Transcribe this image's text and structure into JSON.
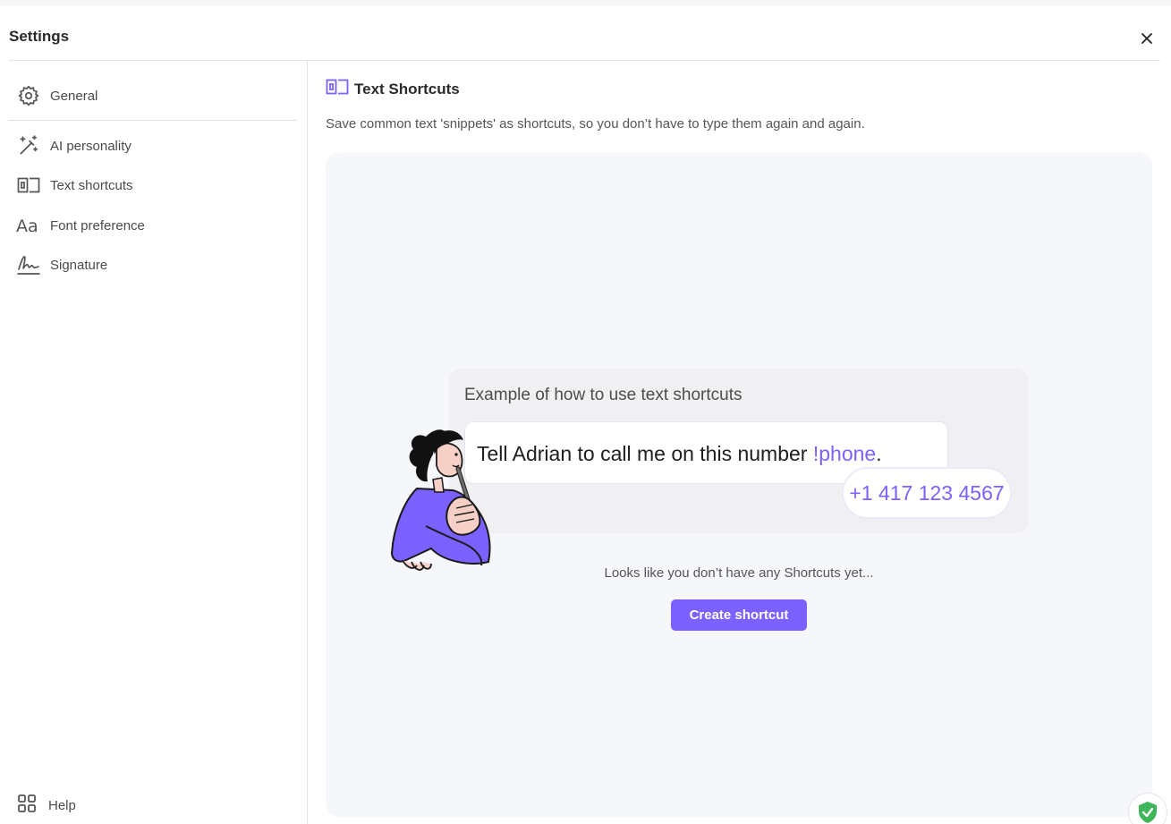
{
  "window": {
    "title": "Settings"
  },
  "sidebar": {
    "items": [
      {
        "label": "General",
        "icon": "gear-icon"
      },
      {
        "label": "AI personality",
        "icon": "magic-wand-icon"
      },
      {
        "label": "Text shortcuts",
        "icon": "text-shortcut-icon"
      },
      {
        "label": "Font preference",
        "icon": "font-icon"
      },
      {
        "label": "Signature",
        "icon": "signature-icon"
      }
    ],
    "help_label": "Help"
  },
  "main": {
    "section_title": "Text Shortcuts",
    "description": "Save common text 'snippets' as shortcuts, so you don’t have to type them again and again.",
    "example": {
      "title": "Example of how to use text shortcuts",
      "text_before": "Tell Adrian to call me on this number ",
      "shortcut": "!phone",
      "text_after": ".",
      "expansion": "+1 417 123 4567"
    },
    "empty_message": "Looks like you don’t have any Shortcuts yet...",
    "create_button": "Create shortcut"
  },
  "colors": {
    "accent": "#7b61ff",
    "panel": "#f6f7fa",
    "shield": "#3fb65a"
  }
}
